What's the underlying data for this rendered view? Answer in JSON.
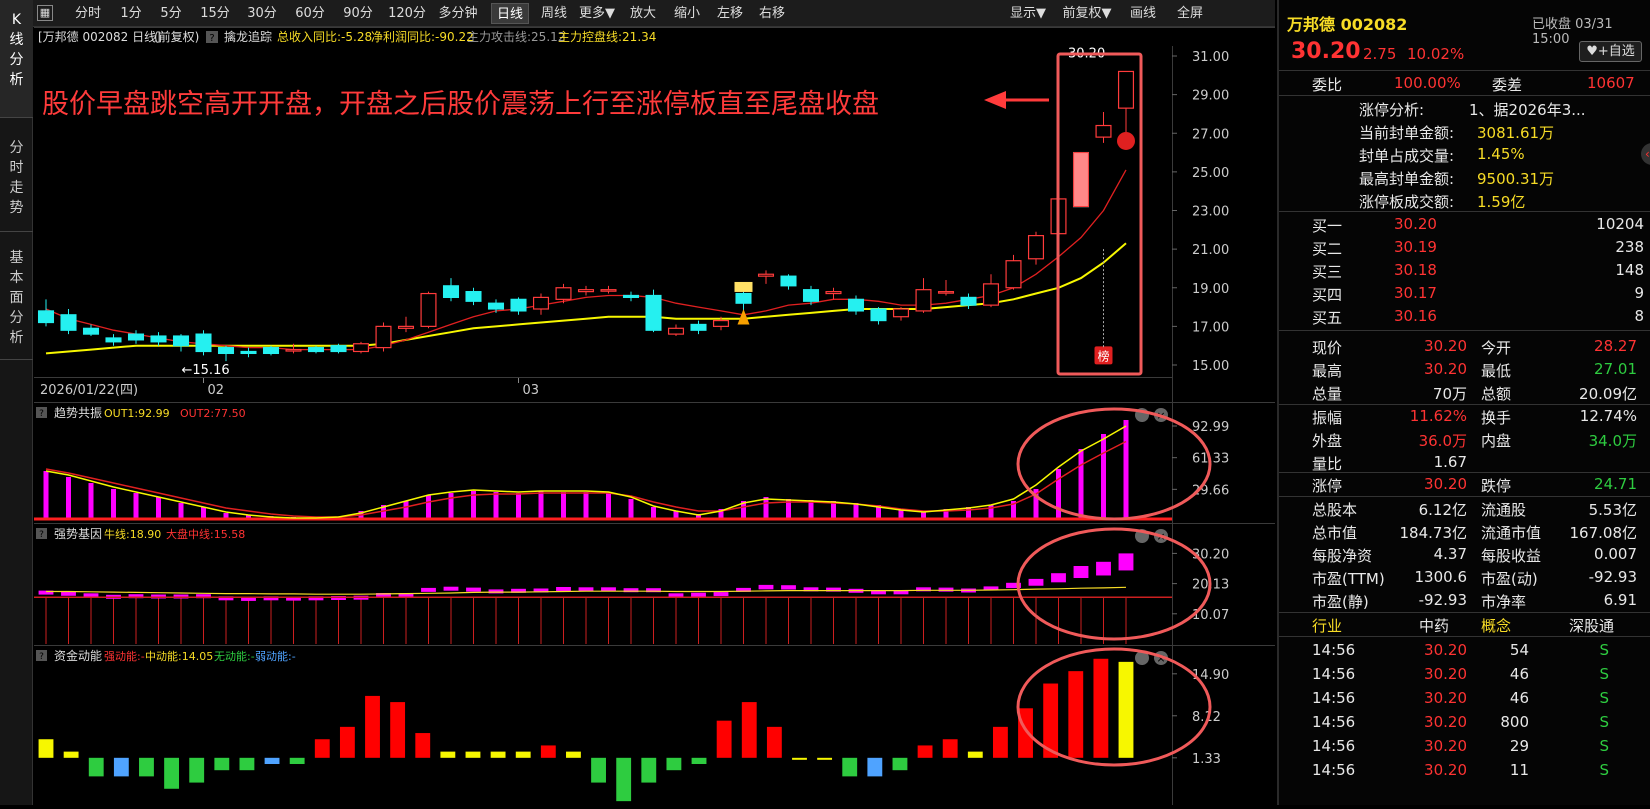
{
  "left_tabs": [
    "K\n线\n分\n析",
    "分\n时\n走\n势",
    "基\n本\n面\n分\n析"
  ],
  "toolbar": {
    "left": [
      "分时",
      "1分",
      "5分",
      "15分",
      "30分",
      "60分",
      "90分",
      "120分",
      "多分钟",
      "日线",
      "周线",
      "更多▼",
      "放大",
      "缩小",
      "左移",
      "右移"
    ],
    "active": "日线",
    "right": [
      "显示▼",
      "前复权▼",
      "画线",
      "全屏"
    ]
  },
  "chart_header": {
    "stock": "[万邦德 002082 日线]",
    "adjust": "(前复权)",
    "indicator": "擒龙追踪",
    "rev": "总收入同比:-5.28",
    "profit": "净利润同比:-90.22",
    "attack": "主力攻击线:25.12",
    "control": "主力控盘线:21.34"
  },
  "annotation": "股价早盘跳空高开开盘，开盘之后股价震荡上行至涨停板直至尾盘收盘",
  "chart_data": [
    {
      "type": "candlestick",
      "name": "main",
      "y_ticks": [
        "31.00",
        "29.00",
        "27.00",
        "25.00",
        "23.00",
        "21.00",
        "19.00",
        "17.00",
        "15.00"
      ],
      "ylim": [
        14.6,
        31.5
      ],
      "x_labels": [
        "2026/01/22(四)",
        "02",
        "03"
      ],
      "candles": [
        [
          17.8,
          17.2,
          18.4,
          17.0
        ],
        [
          17.6,
          16.8,
          17.9,
          16.6
        ],
        [
          16.9,
          16.6,
          17.1,
          16.5
        ],
        [
          16.4,
          16.2,
          16.6,
          16.0
        ],
        [
          16.6,
          16.3,
          16.8,
          16.1
        ],
        [
          16.5,
          16.2,
          16.7,
          16.0
        ],
        [
          16.5,
          16.0,
          16.6,
          15.7
        ],
        [
          16.6,
          15.7,
          16.8,
          15.5
        ],
        [
          15.9,
          15.6,
          16.0,
          15.2
        ],
        [
          15.7,
          15.6,
          15.9,
          15.4
        ],
        [
          15.9,
          15.6,
          16.0,
          15.5
        ],
        [
          15.8,
          15.8,
          16.1,
          15.6
        ],
        [
          15.9,
          15.7,
          16.0,
          15.6
        ],
        [
          16.0,
          15.7,
          16.1,
          15.6
        ],
        [
          15.7,
          16.1,
          16.2,
          15.6
        ],
        [
          15.9,
          17.0,
          17.2,
          15.7
        ],
        [
          16.9,
          17.0,
          17.5,
          16.7
        ],
        [
          17.0,
          18.7,
          18.8,
          16.9
        ],
        [
          19.1,
          18.5,
          19.5,
          18.3
        ],
        [
          18.8,
          18.3,
          19.0,
          18.1
        ],
        [
          18.2,
          17.9,
          18.4,
          17.7
        ],
        [
          18.4,
          17.8,
          18.5,
          17.6
        ],
        [
          17.9,
          18.5,
          18.7,
          17.6
        ],
        [
          18.4,
          19.0,
          19.2,
          18.2
        ],
        [
          18.8,
          18.9,
          19.1,
          18.6
        ],
        [
          18.9,
          18.9,
          19.1,
          18.7
        ],
        [
          18.6,
          18.5,
          18.8,
          18.3
        ],
        [
          18.6,
          16.8,
          18.9,
          16.7
        ],
        [
          16.6,
          16.9,
          17.1,
          16.5
        ],
        [
          17.1,
          16.8,
          17.3,
          16.6
        ],
        [
          17.0,
          17.3,
          17.5,
          16.8
        ],
        [
          18.7,
          18.2,
          18.8,
          17.6
        ],
        [
          19.6,
          19.7,
          19.9,
          19.2
        ],
        [
          19.6,
          19.1,
          19.7,
          18.9
        ],
        [
          18.9,
          18.3,
          19.1,
          18.1
        ],
        [
          18.7,
          18.8,
          19.0,
          18.4
        ],
        [
          18.4,
          17.8,
          18.6,
          17.6
        ],
        [
          17.9,
          17.3,
          18.0,
          17.1
        ],
        [
          17.5,
          17.9,
          18.0,
          17.3
        ],
        [
          17.8,
          18.9,
          19.5,
          17.7
        ],
        [
          18.8,
          18.8,
          19.4,
          18.6
        ],
        [
          18.5,
          18.1,
          18.7,
          17.9
        ],
        [
          18.1,
          19.2,
          19.7,
          18.0
        ],
        [
          19.0,
          20.4,
          20.7,
          18.9
        ],
        [
          20.5,
          21.7,
          21.9,
          20.2
        ],
        [
          21.8,
          23.6,
          23.9,
          21.5
        ],
        [
          26.0,
          23.2,
          26.0,
          23.2
        ],
        [
          26.8,
          27.4,
          28.1,
          26.5
        ],
        [
          28.3,
          30.2,
          30.2,
          27.0
        ]
      ],
      "ma_red": [
        17.9,
        17.4,
        17.1,
        16.8,
        16.6,
        16.4,
        16.2,
        16.1,
        16.0,
        15.9,
        15.9,
        15.8,
        15.8,
        15.8,
        15.8,
        16.0,
        16.3,
        16.7,
        17.1,
        17.5,
        17.8,
        17.9,
        18.1,
        18.3,
        18.5,
        18.6,
        18.6,
        18.5,
        18.2,
        18.0,
        17.8,
        17.6,
        17.8,
        18.1,
        18.2,
        18.4,
        18.4,
        18.3,
        18.1,
        18.1,
        18.2,
        18.4,
        18.6,
        19.0,
        19.7,
        20.6,
        21.6,
        23.0,
        25.1
      ],
      "ma_yellow": [
        15.6,
        15.7,
        15.8,
        15.9,
        16.0,
        16.0,
        16.0,
        16.0,
        16.0,
        16.0,
        16.0,
        16.0,
        16.0,
        16.0,
        16.0,
        16.1,
        16.3,
        16.5,
        16.7,
        16.9,
        17.0,
        17.1,
        17.2,
        17.3,
        17.4,
        17.5,
        17.5,
        17.5,
        17.4,
        17.4,
        17.4,
        17.4,
        17.5,
        17.6,
        17.7,
        17.8,
        17.9,
        17.9,
        17.9,
        17.9,
        18.0,
        18.1,
        18.2,
        18.4,
        18.7,
        19.0,
        19.5,
        20.3,
        21.3
      ],
      "labels": {
        "low": "15.16",
        "high": "30.20",
        "badge": "榜"
      }
    },
    {
      "type": "bar",
      "name": "趋势共振",
      "legend": [
        "OUT1:92.99",
        "OUT2:77.50"
      ],
      "y_ticks": [
        "92.99",
        "61.33",
        "29.66"
      ],
      "ylim": [
        0,
        100
      ],
      "values": [
        48,
        42,
        36,
        30,
        26,
        22,
        16,
        12,
        6,
        4,
        3,
        2,
        2,
        2,
        8,
        14,
        18,
        24,
        26,
        28,
        27,
        26,
        28,
        27,
        27,
        26,
        20,
        12,
        8,
        5,
        10,
        18,
        22,
        20,
        19,
        18,
        16,
        14,
        10,
        8,
        10,
        12,
        14,
        18,
        30,
        50,
        70,
        85,
        99
      ],
      "line1": [
        48,
        44,
        38,
        32,
        27,
        22,
        17,
        12,
        7,
        4,
        2,
        1,
        1,
        2,
        6,
        12,
        18,
        24,
        27,
        29,
        28,
        27,
        28,
        28,
        28,
        27,
        22,
        13,
        8,
        4,
        8,
        16,
        20,
        19,
        18,
        17,
        15,
        12,
        9,
        7,
        9,
        11,
        14,
        20,
        34,
        52,
        68,
        80,
        92.99
      ],
      "line2": [
        50,
        46,
        41,
        36,
        31,
        26,
        21,
        16,
        11,
        8,
        5,
        3,
        2,
        2,
        4,
        8,
        12,
        17,
        21,
        24,
        25,
        25,
        26,
        26,
        26,
        26,
        23,
        17,
        12,
        8,
        8,
        12,
        16,
        17,
        17,
        16,
        15,
        13,
        10,
        8,
        8,
        9,
        11,
        15,
        25,
        40,
        54,
        66,
        77.5
      ]
    },
    {
      "type": "bar",
      "name": "强势基因",
      "legend": [
        "牛线:18.90",
        "大盘中线:15.58"
      ],
      "y_ticks": [
        "30.20",
        "20.13",
        "10.07"
      ],
      "ylim": [
        0,
        34
      ],
      "values": [
        17.8,
        17.4,
        16.9,
        16.4,
        16.6,
        16.5,
        16.5,
        16.6,
        15.9,
        15.7,
        15.9,
        15.8,
        15.9,
        16.0,
        16.1,
        17.0,
        17.0,
        18.7,
        19.1,
        18.8,
        18.2,
        18.4,
        18.5,
        19.0,
        18.9,
        18.9,
        18.6,
        18.6,
        16.9,
        17.1,
        17.3,
        18.7,
        19.7,
        19.6,
        18.9,
        18.8,
        18.4,
        17.9,
        17.9,
        18.9,
        18.8,
        18.5,
        19.2,
        20.4,
        21.7,
        23.6,
        26.0,
        27.4,
        30.2
      ],
      "bull_line": [
        17.5,
        17.5,
        17.4,
        17.3,
        17.2,
        17.1,
        17.0,
        16.9,
        16.8,
        16.8,
        16.7,
        16.7,
        16.6,
        16.6,
        16.6,
        16.7,
        16.8,
        16.9,
        17.0,
        17.2,
        17.3,
        17.3,
        17.4,
        17.5,
        17.6,
        17.6,
        17.6,
        17.6,
        17.5,
        17.5,
        17.5,
        17.6,
        17.7,
        17.8,
        17.8,
        17.8,
        17.8,
        17.8,
        17.8,
        17.9,
        17.9,
        17.9,
        18.0,
        18.1,
        18.3,
        18.4,
        18.6,
        18.7,
        18.9
      ],
      "base": 15.58
    },
    {
      "type": "bar",
      "name": "资金动能",
      "legend": [
        "强动能:-",
        "中动能:14.05",
        "无动能:-",
        "弱动能:-"
      ],
      "y_ticks": [
        "14.90",
        "8.12",
        "1.33"
      ],
      "ylim": [
        -5,
        16
      ],
      "values": [
        3,
        1,
        -3,
        -3,
        -3,
        -5,
        -4,
        -2,
        -2,
        -1,
        -1,
        3,
        5,
        10,
        9,
        4,
        1,
        1,
        1,
        1,
        2,
        1,
        -4,
        -7,
        -4,
        -2,
        -1,
        6,
        9,
        5,
        0,
        0,
        -3,
        -3,
        -2,
        2,
        3,
        1,
        5,
        8,
        12,
        14,
        16,
        15.5
      ]
    }
  ],
  "side": {
    "name": "万邦德 002082",
    "status": "已收盘 03/31 15:00",
    "price": "30.20",
    "chg": "2.75",
    "pct": "10.02%",
    "self_btn": "+自选",
    "webi_l": "委比",
    "webi_v": "100.00%",
    "wecha_l": "委差",
    "wecha_v": "10607",
    "limit": [
      [
        "涨停分析:",
        "1、据2026年3..."
      ],
      [
        "当前封单金额:",
        "3081.61万"
      ],
      [
        "封单占成交量:",
        "1.45%"
      ],
      [
        "最高封单金额:",
        "9500.31万"
      ],
      [
        "涨停板成交额:",
        "1.59亿"
      ]
    ],
    "bids": [
      [
        "买一",
        "30.20",
        "10204"
      ],
      [
        "买二",
        "30.19",
        "238"
      ],
      [
        "买三",
        "30.18",
        "148"
      ],
      [
        "买四",
        "30.17",
        "9"
      ],
      [
        "买五",
        "30.16",
        "8"
      ]
    ],
    "quote": [
      [
        "现价",
        "30.20",
        "今开",
        "28.27"
      ],
      [
        "最高",
        "30.20",
        "最低",
        "27.01"
      ],
      [
        "总量",
        "70万",
        "总额",
        "20.09亿"
      ]
    ],
    "quote2": [
      [
        "振幅",
        "11.62%",
        "换手",
        "12.74%"
      ],
      [
        "外盘",
        "36.0万",
        "内盘",
        "34.0万"
      ],
      [
        "量比",
        "1.67",
        "",
        ""
      ]
    ],
    "quote3": [
      [
        "涨停",
        "30.20",
        "跌停",
        "24.71"
      ]
    ],
    "fund": [
      [
        "总股本",
        "6.12亿",
        "流通股",
        "5.53亿"
      ],
      [
        "总市值",
        "184.73亿",
        "流通市值",
        "167.08亿"
      ],
      [
        "每股净资",
        "4.37",
        "每股收益",
        "0.007"
      ],
      [
        "市盈(TTM)",
        "1300.6",
        "市盈(动)",
        "-92.93"
      ],
      [
        "市盈(静)",
        "-92.93",
        "市净率",
        "6.91"
      ]
    ],
    "ind": [
      "行业",
      "中药",
      "概念",
      "深股通"
    ],
    "ticks": [
      [
        "14:56",
        "30.20",
        "54",
        "S"
      ],
      [
        "14:56",
        "30.20",
        "46",
        "S"
      ],
      [
        "14:56",
        "30.20",
        "46",
        "S"
      ],
      [
        "14:56",
        "30.20",
        "800",
        "S"
      ],
      [
        "14:56",
        "30.20",
        "29",
        "S"
      ],
      [
        "14:56",
        "30.20",
        "11",
        "S"
      ]
    ]
  }
}
